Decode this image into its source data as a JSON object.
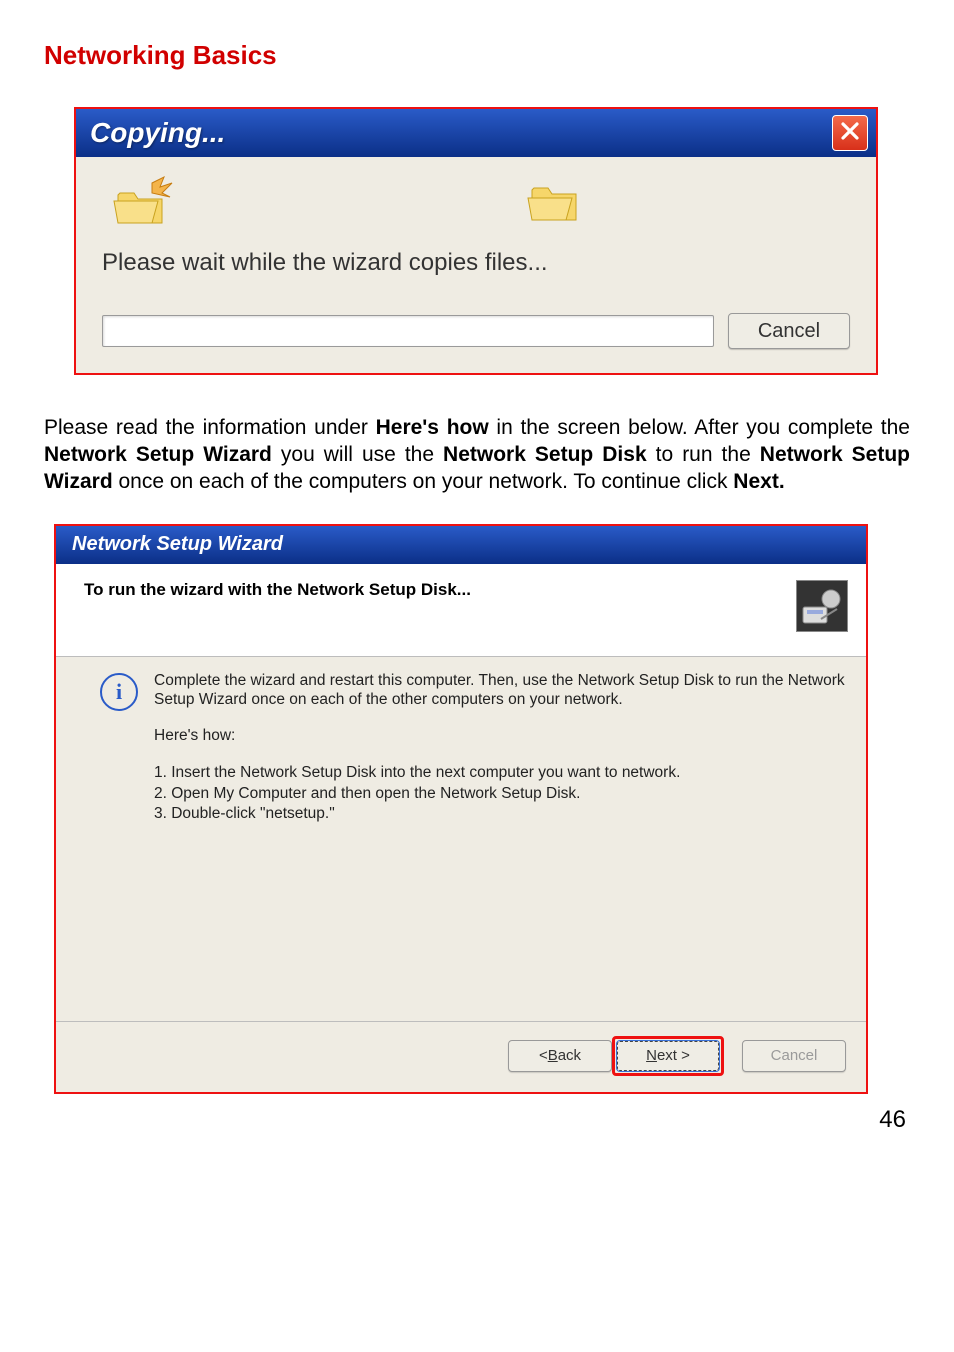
{
  "page_title": "Networking Basics",
  "page_number": "46",
  "dialog1": {
    "title": "Copying...",
    "message": "Please wait while the wizard copies files...",
    "cancel_label": "Cancel"
  },
  "mid_para": {
    "t1": "Please read the information under ",
    "b1": "Here's how",
    "t2": " in the screen below.  After you complete the ",
    "b2": "Network Setup Wizard",
    "t3": " you will use the ",
    "b3": "Network Setup Disk",
    "t4": " to run the ",
    "b4": "Network Setup Wizard",
    "t5": " once on each of the computers on your network.  To continue click ",
    "b5": "Next."
  },
  "dialog2": {
    "title": "Network Setup Wizard",
    "heading": "To run the wizard with the Network Setup Disk...",
    "info_text": "Complete the wizard and restart this computer. Then, use the Network Setup Disk to run the Network Setup Wizard once on each of the other computers on your network.",
    "heres_how": "Here's how:",
    "step1": "1.  Insert the Network Setup Disk into the next computer you want to network.",
    "step2": "2.  Open My Computer and then open the Network Setup Disk.",
    "step3": "3.  Double-click \"netsetup.\"",
    "back_prefix": "< ",
    "back_u": "B",
    "back_suffix": "ack",
    "next_u": "N",
    "next_suffix": "ext >",
    "cancel_label": "Cancel"
  }
}
